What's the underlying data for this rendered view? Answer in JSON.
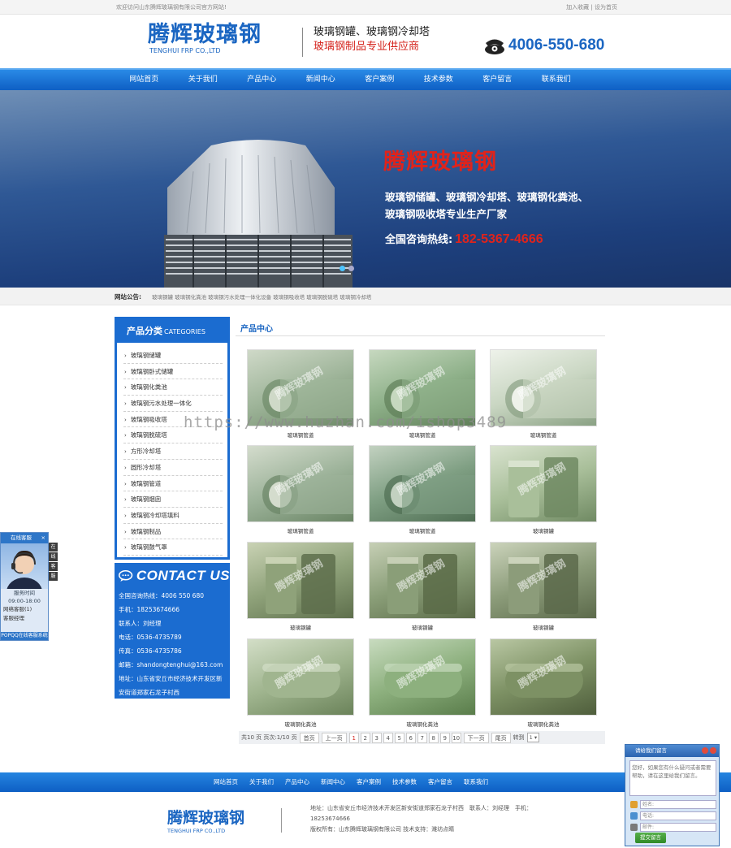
{
  "topbar": {
    "welcome": "欢迎访问山东腾辉玻璃钢有限公司官方网站!",
    "add_favorite": "加入收藏",
    "separator": "|",
    "set_home": "设为首页"
  },
  "header": {
    "logo_cn": "腾辉玻璃钢",
    "logo_en": "TENGHUI FRP CO.,LTD",
    "slogan_line1": "玻璃钢罐、玻璃钢冷却塔",
    "slogan_line2": "玻璃钢制品专业供应商",
    "phone_icon": "telephone-icon",
    "phone": "4006-550-680"
  },
  "nav": [
    "网站首页",
    "关于我们",
    "产品中心",
    "新闻中心",
    "客户案例",
    "技术参数",
    "客户留言",
    "联系我们"
  ],
  "banner": {
    "title": "腾辉玻璃钢",
    "desc_line1": "玻璃钢储罐、玻璃钢冷却塔、玻璃钢化粪池、",
    "desc_line2": "玻璃钢吸收塔专业生产厂家",
    "hotline_label": "全国咨询热线:",
    "hotline": "182-5367-4666"
  },
  "notice": {
    "label": "网站公告:",
    "text": "玻璃钢罐 玻璃钢化粪池 玻璃钢污水处理一体化设备 玻璃钢吸收塔 玻璃钢脱硫塔 玻璃钢冷却塔"
  },
  "sidebar": {
    "cat_title_cn": "产品分类",
    "cat_title_en": "CATEGORIES",
    "categories": [
      "玻璃钢储罐",
      "玻璃钢卧式储罐",
      "玻璃钢化粪池",
      "玻璃钢污水处理一体化",
      "玻璃钢吸收塔",
      "玻璃钢脱硫塔",
      "方形冷却塔",
      "圆形冷却塔",
      "玻璃钢管道",
      "玻璃钢烟囱",
      "玻璃钢冷却塔填料",
      "玻璃钢制品",
      "玻璃钢鼓气罩"
    ],
    "contact_title": "CONTACT US",
    "contact": {
      "hotline": "全国咨询热线：4006 550 680",
      "mobile": "手机：18253674666",
      "person": "联系人：刘经理",
      "tel": "电话：0536-4735789",
      "fax": "传真：0536-4735786",
      "email": "邮箱：shandongtenghui@163.com",
      "address1": "地址：山东省安丘市经济技术开发区新",
      "address2": "安街道郑家石龙子村西"
    }
  },
  "main": {
    "title": "产品中心",
    "watermark_text": "腾辉玻璃钢",
    "products": [
      {
        "caption": "玻璃钢管道"
      },
      {
        "caption": "玻璃钢管道"
      },
      {
        "caption": "玻璃钢管道"
      },
      {
        "caption": "玻璃钢管道"
      },
      {
        "caption": "玻璃钢管道"
      },
      {
        "caption": "玻璃钢罐"
      },
      {
        "caption": "玻璃钢罐"
      },
      {
        "caption": "玻璃钢罐"
      },
      {
        "caption": "玻璃钢罐"
      },
      {
        "caption": "玻璃钢化粪池"
      },
      {
        "caption": "玻璃钢化粪池"
      },
      {
        "caption": "玻璃钢化粪池"
      }
    ],
    "pager": {
      "info": "共10 页 页次:1/10 页",
      "first": "首页",
      "prev": "上一页",
      "next": "下一页",
      "last": "尾页",
      "pages": [
        "1",
        "2",
        "3",
        "4",
        "5",
        "6",
        "7",
        "8",
        "9",
        "10"
      ],
      "current": "1",
      "goto_label": "转到",
      "goto_value": "1"
    }
  },
  "overlay_watermark": "https://www.huzhan.com/ishop3489",
  "footer_nav": [
    "网站首页",
    "关于我们",
    "产品中心",
    "新闻中心",
    "客户案例",
    "技术参数",
    "客户留言",
    "联系我们"
  ],
  "footer": {
    "logo_cn": "腾辉玻璃钢",
    "logo_en": "TENGHUI FRP CO.,LTD",
    "address": "地址：山东省安丘市经济技术开发区新安街道郑家石龙子村西　联系人：刘经理　手机：18253674666",
    "copyright": "版权所有：山东腾辉玻璃钢有限公司 技术支持：潍坊点睛"
  },
  "qq_widget": {
    "title": "在线客服",
    "close": "×",
    "time_label": "服务时间",
    "time": "09:00-18:00",
    "item1": "网络客服(1)",
    "item2": "客服经理",
    "footer": "POPQQ在线客服系统",
    "tabs": [
      "在",
      "线",
      "客",
      "服"
    ]
  },
  "chat_widget": {
    "title": "请给我们留言",
    "placeholder": "您好，如果您有什么疑问或者需要帮助，请在这里给我们留言。",
    "name_placeholder": "姓名:",
    "phone_placeholder": "电话:",
    "email_placeholder": "邮件:",
    "send": "提交留言"
  },
  "colors": {
    "brand_blue": "#1b66c2",
    "accent_red": "#e0231b",
    "nav_blue": "#0e5fc4"
  }
}
